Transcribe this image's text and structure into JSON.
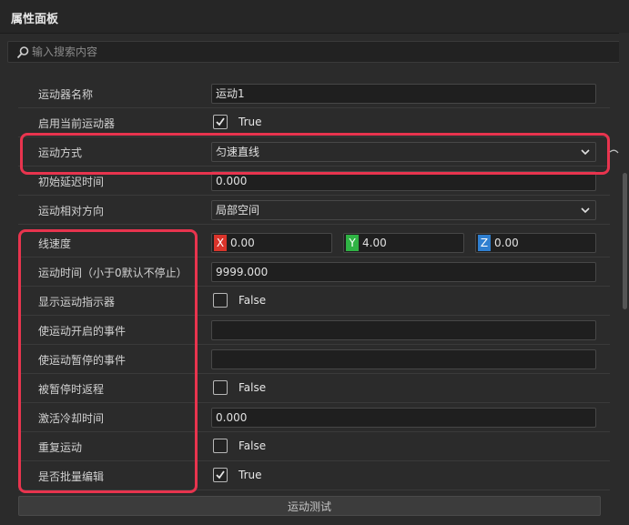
{
  "panel": {
    "title": "属性面板"
  },
  "search": {
    "placeholder": "输入搜索内容"
  },
  "rows": {
    "name": {
      "label": "运动器名称",
      "value": "运动1"
    },
    "enable": {
      "label": "启用当前运动器",
      "value": "True"
    },
    "mode": {
      "label": "运动方式",
      "value": "匀速直线"
    },
    "delay": {
      "label": "初始延迟时间",
      "value": "0.000"
    },
    "direction": {
      "label": "运动相对方向",
      "value": "局部空间"
    },
    "speed": {
      "label": "线速度",
      "x": {
        "tag": "X",
        "value": "0.00",
        "color": "#d9342b"
      },
      "y": {
        "tag": "Y",
        "value": "4.00",
        "color": "#2fb344"
      },
      "z": {
        "tag": "Z",
        "value": "0.00",
        "color": "#2f7fd0"
      }
    },
    "duration": {
      "label": "运动时间（小于0默认不停止）",
      "value": "9999.000"
    },
    "indicator": {
      "label": "显示运动指示器",
      "value": "False"
    },
    "start_event": {
      "label": "使运动开启的事件",
      "value": ""
    },
    "pause_event": {
      "label": "使运动暂停的事件",
      "value": ""
    },
    "return_on_pause": {
      "label": "被暂停时返程",
      "value": "False"
    },
    "cooldown": {
      "label": "激活冷却时间",
      "value": "0.000"
    },
    "repeat": {
      "label": "重复运动",
      "value": "False"
    },
    "batch": {
      "label": "是否批量编辑",
      "value": "True"
    }
  },
  "footer": {
    "test_button": "运动测试"
  },
  "colors": {
    "highlight": "#e8344e",
    "background": "#2b2b2b"
  }
}
